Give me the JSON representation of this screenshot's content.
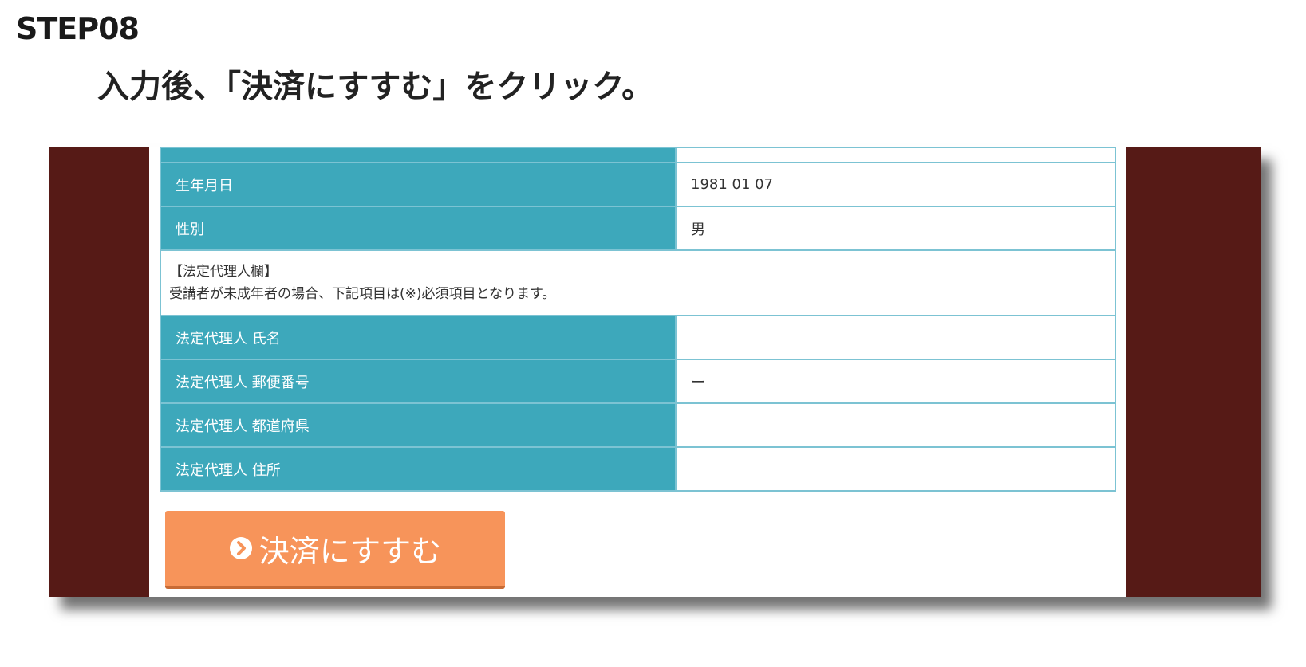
{
  "header": {
    "step": "STEP08",
    "instruction": "入力後、「決済にすすむ」をクリック。"
  },
  "form": {
    "rows": [
      {
        "label": "",
        "value": ""
      },
      {
        "label": "生年月日",
        "value": "1981 01 07"
      },
      {
        "label": "性別",
        "value": "男"
      }
    ],
    "note": {
      "heading": "【法定代理人欄】",
      "text": "受講者が未成年者の場合、下記項目は(※)必須項目となります。"
    },
    "guardian_rows": [
      {
        "label": "法定代理人 氏名",
        "value": ""
      },
      {
        "label": "法定代理人 郵便番号",
        "value": "ー"
      },
      {
        "label": "法定代理人 都道府県",
        "value": ""
      },
      {
        "label": "法定代理人 住所",
        "value": ""
      }
    ]
  },
  "submit": {
    "label": "決済にすすむ",
    "icon": "circle-arrow-right-icon"
  },
  "colors": {
    "frame": "#561a16",
    "label_bg": "#3da8bb",
    "border": "#7cc3d3",
    "button": "#f7945a"
  }
}
